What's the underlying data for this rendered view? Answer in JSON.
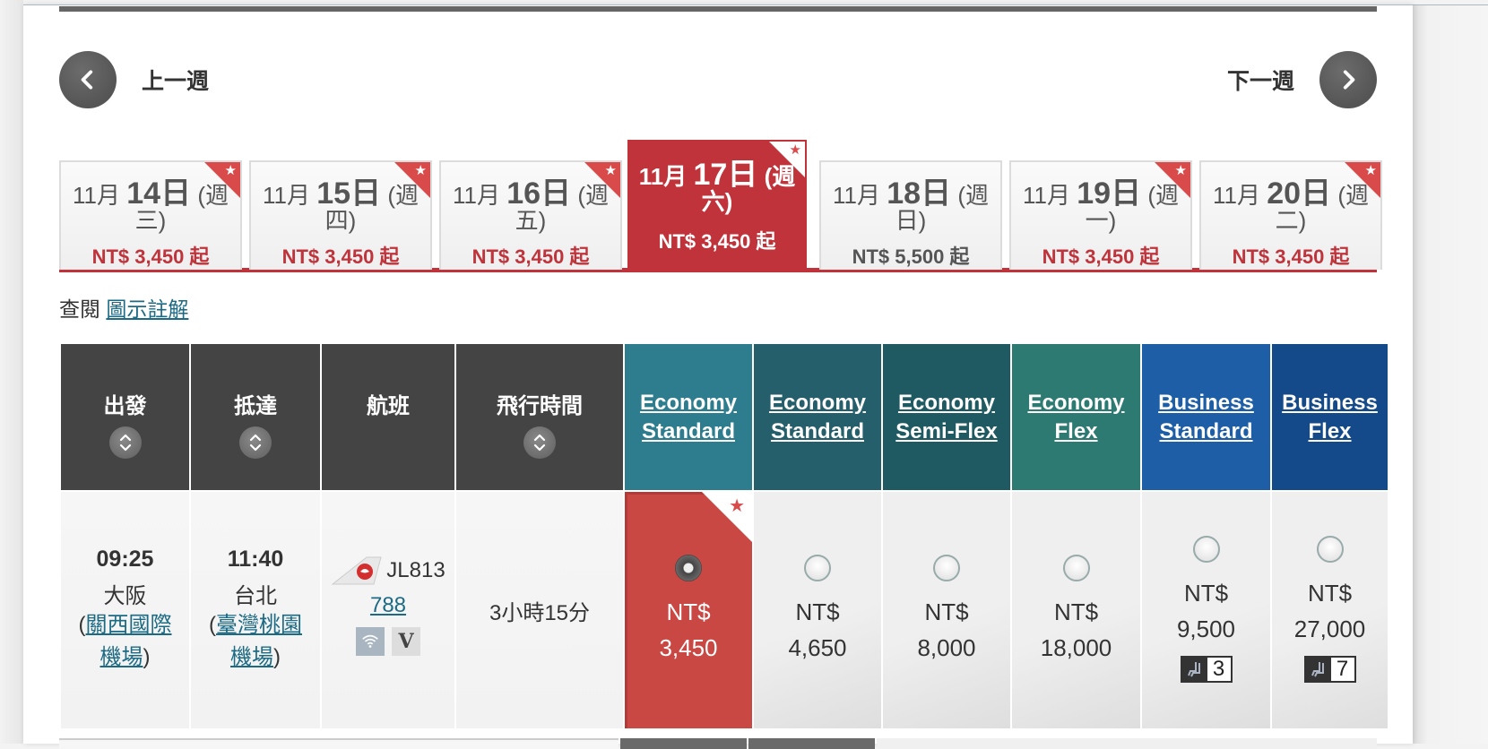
{
  "nav": {
    "prev_week": "上一週",
    "next_week": "下一週"
  },
  "dates": [
    {
      "month": "11月",
      "day": "14日",
      "weekday": "(週",
      "weekday2": "三)",
      "price": "NT$ 3,450 起",
      "lowest": true,
      "active": false
    },
    {
      "month": "11月",
      "day": "15日",
      "weekday": "(週",
      "weekday2": "四)",
      "price": "NT$ 3,450 起",
      "lowest": true,
      "active": false
    },
    {
      "month": "11月",
      "day": "16日",
      "weekday": "(週",
      "weekday2": "五)",
      "price": "NT$ 3,450 起",
      "lowest": true,
      "active": false
    },
    {
      "month": "11月",
      "day": "17日",
      "weekday": "(週",
      "weekday2": "六)",
      "price": "NT$ 3,450 起",
      "lowest": true,
      "active": true
    },
    {
      "month": "11月",
      "day": "18日",
      "weekday": "(週",
      "weekday2": "日)",
      "price": "NT$ 5,500 起",
      "lowest": false,
      "active": false
    },
    {
      "month": "11月",
      "day": "19日",
      "weekday": "(週",
      "weekday2": "一)",
      "price": "NT$ 3,450 起",
      "lowest": true,
      "active": false
    },
    {
      "month": "11月",
      "day": "20日",
      "weekday": "(週",
      "weekday2": "二)",
      "price": "NT$ 3,450 起",
      "lowest": true,
      "active": false
    }
  ],
  "legend": {
    "prefix": "查閱",
    "link": "圖示註解"
  },
  "table": {
    "headers": {
      "depart": "出發",
      "arrive": "抵達",
      "flight": "航班",
      "duration": "飛行時間"
    },
    "fare_headers": [
      {
        "line1": "Economy",
        "line2": "Standard",
        "color": "#2e7d8f"
      },
      {
        "line1": "Economy",
        "line2": "Standard",
        "color": "#255f6c"
      },
      {
        "line1": "Economy",
        "line2": "Semi-Flex",
        "color": "#1f5a63"
      },
      {
        "line1": "Economy",
        "line2": "Flex",
        "color": "#2d7a73"
      },
      {
        "line1": "Business",
        "line2": "Standard",
        "color": "#1d5ea6"
      },
      {
        "line1": "Business",
        "line2": "Flex",
        "color": "#154a8a"
      }
    ],
    "rows": [
      {
        "depart_time": "09:25",
        "depart_city": "大阪",
        "depart_airport_open": "(",
        "depart_airport_1": "關西國際",
        "depart_airport_2": "機場",
        "depart_airport_close": ")",
        "arrive_time": "11:40",
        "arrive_city": "台北",
        "arrive_airport_open": "(",
        "arrive_airport_1": "臺灣桃園",
        "arrive_airport_2": "機場",
        "arrive_airport_close": ")",
        "flight_number": "JL813",
        "aircraft": "788",
        "amenities": [
          "wifi-icon",
          "magic-entertainment-icon"
        ],
        "duration": "3小時15分",
        "fares": [
          {
            "currency": "NT$",
            "amount": "3,450",
            "selected": true,
            "lowest": true,
            "seats": null
          },
          {
            "currency": "NT$",
            "amount": "4,650",
            "selected": false,
            "lowest": false,
            "seats": null
          },
          {
            "currency": "NT$",
            "amount": "8,000",
            "selected": false,
            "lowest": false,
            "seats": null
          },
          {
            "currency": "NT$",
            "amount": "18,000",
            "selected": false,
            "lowest": false,
            "seats": null
          },
          {
            "currency": "NT$",
            "amount": "9,500",
            "selected": false,
            "lowest": false,
            "seats": "3"
          },
          {
            "currency": "NT$",
            "amount": "27,000",
            "selected": false,
            "lowest": false,
            "seats": "7"
          }
        ]
      }
    ]
  },
  "colors": {
    "accent_red": "#c0333a",
    "header_dark": "#444444",
    "link": "#1d6a84"
  }
}
